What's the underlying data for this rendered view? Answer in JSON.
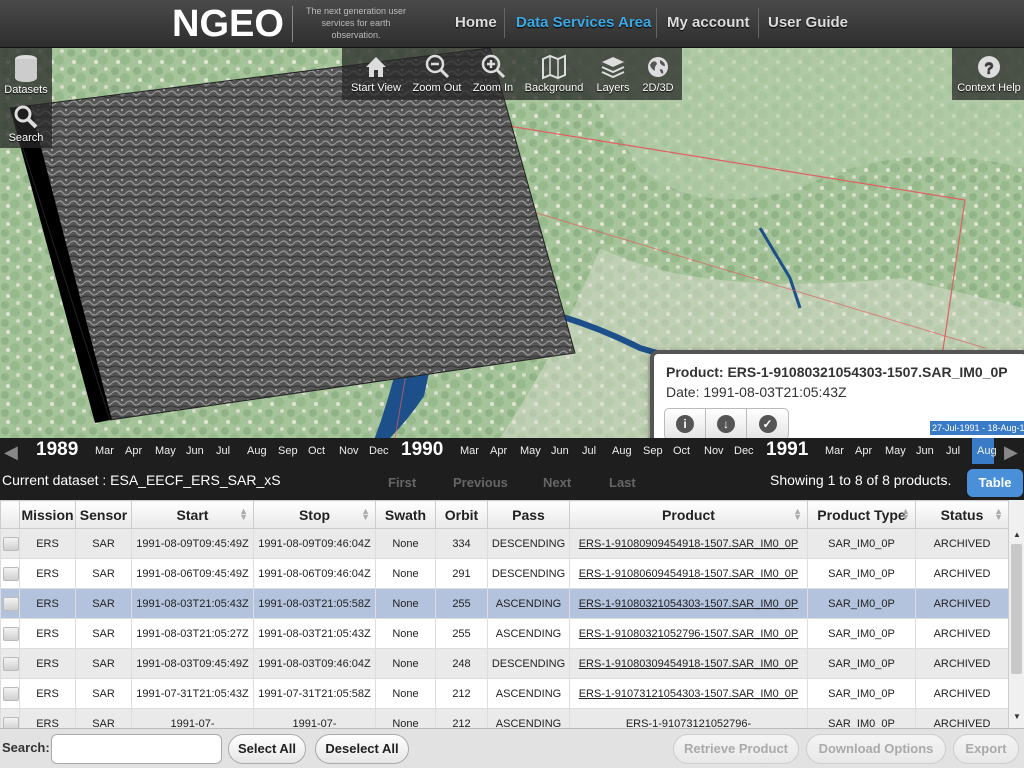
{
  "header": {
    "logo": "NGEO",
    "tagline": "The next generation user services for earth observation.",
    "nav": [
      "Home",
      "Data Services Area",
      "My account",
      "User Guide"
    ]
  },
  "map_toolbar": {
    "left": [
      {
        "label": "Datasets",
        "icon": "database-icon"
      },
      {
        "label": "Search",
        "icon": "search-icon"
      }
    ],
    "center": [
      {
        "label": "Start View",
        "icon": "home-icon"
      },
      {
        "label": "Zoom Out",
        "icon": "zoom-out-icon"
      },
      {
        "label": "Zoom In",
        "icon": "zoom-in-icon"
      },
      {
        "label": "Background",
        "icon": "map-icon"
      },
      {
        "label": "Layers",
        "icon": "layers-icon"
      },
      {
        "label": "2D/3D",
        "icon": "globe-icon"
      }
    ],
    "right": {
      "label": "Context Help",
      "icon": "help-icon"
    }
  },
  "popup": {
    "product": "Product: ERS-1-91080321054303-1507.SAR_IM0_0P",
    "date": "Date: 1991-08-03T21:05:43Z"
  },
  "timeline": {
    "selected_dates": "27-Jul-1991 - 18-Aug-1",
    "years": [
      "1989",
      "1990",
      "1991"
    ],
    "months_1989": [
      "Mar",
      "Apr",
      "May",
      "Jun",
      "Jul",
      "Aug",
      "Sep",
      "Oct",
      "Nov",
      "Dec"
    ],
    "months_1990": [
      "Mar",
      "Apr",
      "May",
      "Jun",
      "Jul",
      "Aug",
      "Sep",
      "Oct",
      "Nov",
      "Dec"
    ],
    "months_1991": [
      "Mar",
      "Apr",
      "May",
      "Jun",
      "Jul",
      "Aug"
    ]
  },
  "results": {
    "current_dataset": "Current dataset : ESA_EECF_ERS_SAR_xS",
    "pager": [
      "First",
      "Previous",
      "Next",
      "Last"
    ],
    "showing": "Showing 1 to 8 of 8 products.",
    "table_button": "Table"
  },
  "table": {
    "columns": [
      "Mission",
      "Sensor",
      "Start",
      "Stop",
      "Swath",
      "Orbit",
      "Pass",
      "Product",
      "Product Type",
      "Status"
    ],
    "rows": [
      {
        "mission": "ERS",
        "sensor": "SAR",
        "start": "1991-08-09T09:45:49Z",
        "stop": "1991-08-09T09:46:04Z",
        "swath": "None",
        "orbit": "334",
        "pass": "DESCENDING",
        "product": "ERS-1-91080909454918-1507.SAR_IM0_0P",
        "type": "SAR_IM0_0P",
        "status": "ARCHIVED"
      },
      {
        "mission": "ERS",
        "sensor": "SAR",
        "start": "1991-08-06T09:45:49Z",
        "stop": "1991-08-06T09:46:04Z",
        "swath": "None",
        "orbit": "291",
        "pass": "DESCENDING",
        "product": "ERS-1-91080609454918-1507.SAR_IM0_0P",
        "type": "SAR_IM0_0P",
        "status": "ARCHIVED"
      },
      {
        "mission": "ERS",
        "sensor": "SAR",
        "start": "1991-08-03T21:05:43Z",
        "stop": "1991-08-03T21:05:58Z",
        "swath": "None",
        "orbit": "255",
        "pass": "ASCENDING",
        "product": "ERS-1-91080321054303-1507.SAR_IM0_0P",
        "type": "SAR_IM0_0P",
        "status": "ARCHIVED"
      },
      {
        "mission": "ERS",
        "sensor": "SAR",
        "start": "1991-08-03T21:05:27Z",
        "stop": "1991-08-03T21:05:43Z",
        "swath": "None",
        "orbit": "255",
        "pass": "ASCENDING",
        "product": "ERS-1-91080321052796-1507.SAR_IM0_0P",
        "type": "SAR_IM0_0P",
        "status": "ARCHIVED"
      },
      {
        "mission": "ERS",
        "sensor": "SAR",
        "start": "1991-08-03T09:45:49Z",
        "stop": "1991-08-03T09:46:04Z",
        "swath": "None",
        "orbit": "248",
        "pass": "DESCENDING",
        "product": "ERS-1-91080309454918-1507.SAR_IM0_0P",
        "type": "SAR_IM0_0P",
        "status": "ARCHIVED"
      },
      {
        "mission": "ERS",
        "sensor": "SAR",
        "start": "1991-07-31T21:05:43Z",
        "stop": "1991-07-31T21:05:58Z",
        "swath": "None",
        "orbit": "212",
        "pass": "ASCENDING",
        "product": "ERS-1-91073121054303-1507.SAR_IM0_0P",
        "type": "SAR_IM0_0P",
        "status": "ARCHIVED"
      },
      {
        "mission": "ERS",
        "sensor": "SAR",
        "start": "1991-07-",
        "stop": "1991-07-",
        "swath": "None",
        "orbit": "212",
        "pass": "ASCENDING",
        "product": "ERS-1-91073121052796-",
        "type": "SAR_IM0_0P",
        "status": "ARCHIVED"
      }
    ]
  },
  "bottom": {
    "search_label": "Search:",
    "search_value": "",
    "select_all": "Select All",
    "deselect_all": "Deselect All",
    "retrieve": "Retrieve Product",
    "download_options": "Download Options",
    "export": "Export"
  }
}
